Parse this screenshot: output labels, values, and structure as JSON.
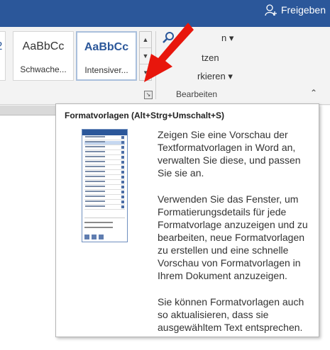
{
  "topbar": {
    "share_label": "Freigeben"
  },
  "styles_gallery": {
    "tiles": [
      {
        "preview": "AaBbCc",
        "name": "Schwache..."
      },
      {
        "preview": "AaBbCc",
        "name": "Intensiver..."
      }
    ],
    "partial_left_name": "."
  },
  "edit_group": {
    "find_label": "n",
    "replace_label": "tzen",
    "select_label": "rkieren",
    "group_label": "Bearbeiten"
  },
  "tooltip": {
    "title": "Formatvorlagen (Alt+Strg+Umschalt+S)",
    "paragraph1": [
      "Zeigen Sie eine Vorschau der",
      "Textformatvorlagen in Word an,",
      "verwalten Sie diese, und passen",
      "Sie sie an."
    ],
    "paragraph2": [
      "Verwenden Sie das Fenster, um",
      "Formatierungsdetails für jede",
      "Formatvorlage anzuzeigen und zu",
      "bearbeiten, neue Formatvorlagen",
      "zu erstellen und eine schnelle",
      "Vorschau von Formatvorlagen in",
      "Ihrem Dokument anzuzeigen."
    ],
    "paragraph3": [
      "Sie können Formatvorlagen auch",
      "so aktualisieren, dass sie",
      "ausgewähltem Text entsprechen."
    ]
  },
  "colors": {
    "accent": "#2b579a",
    "arrow": "#e8160c"
  }
}
